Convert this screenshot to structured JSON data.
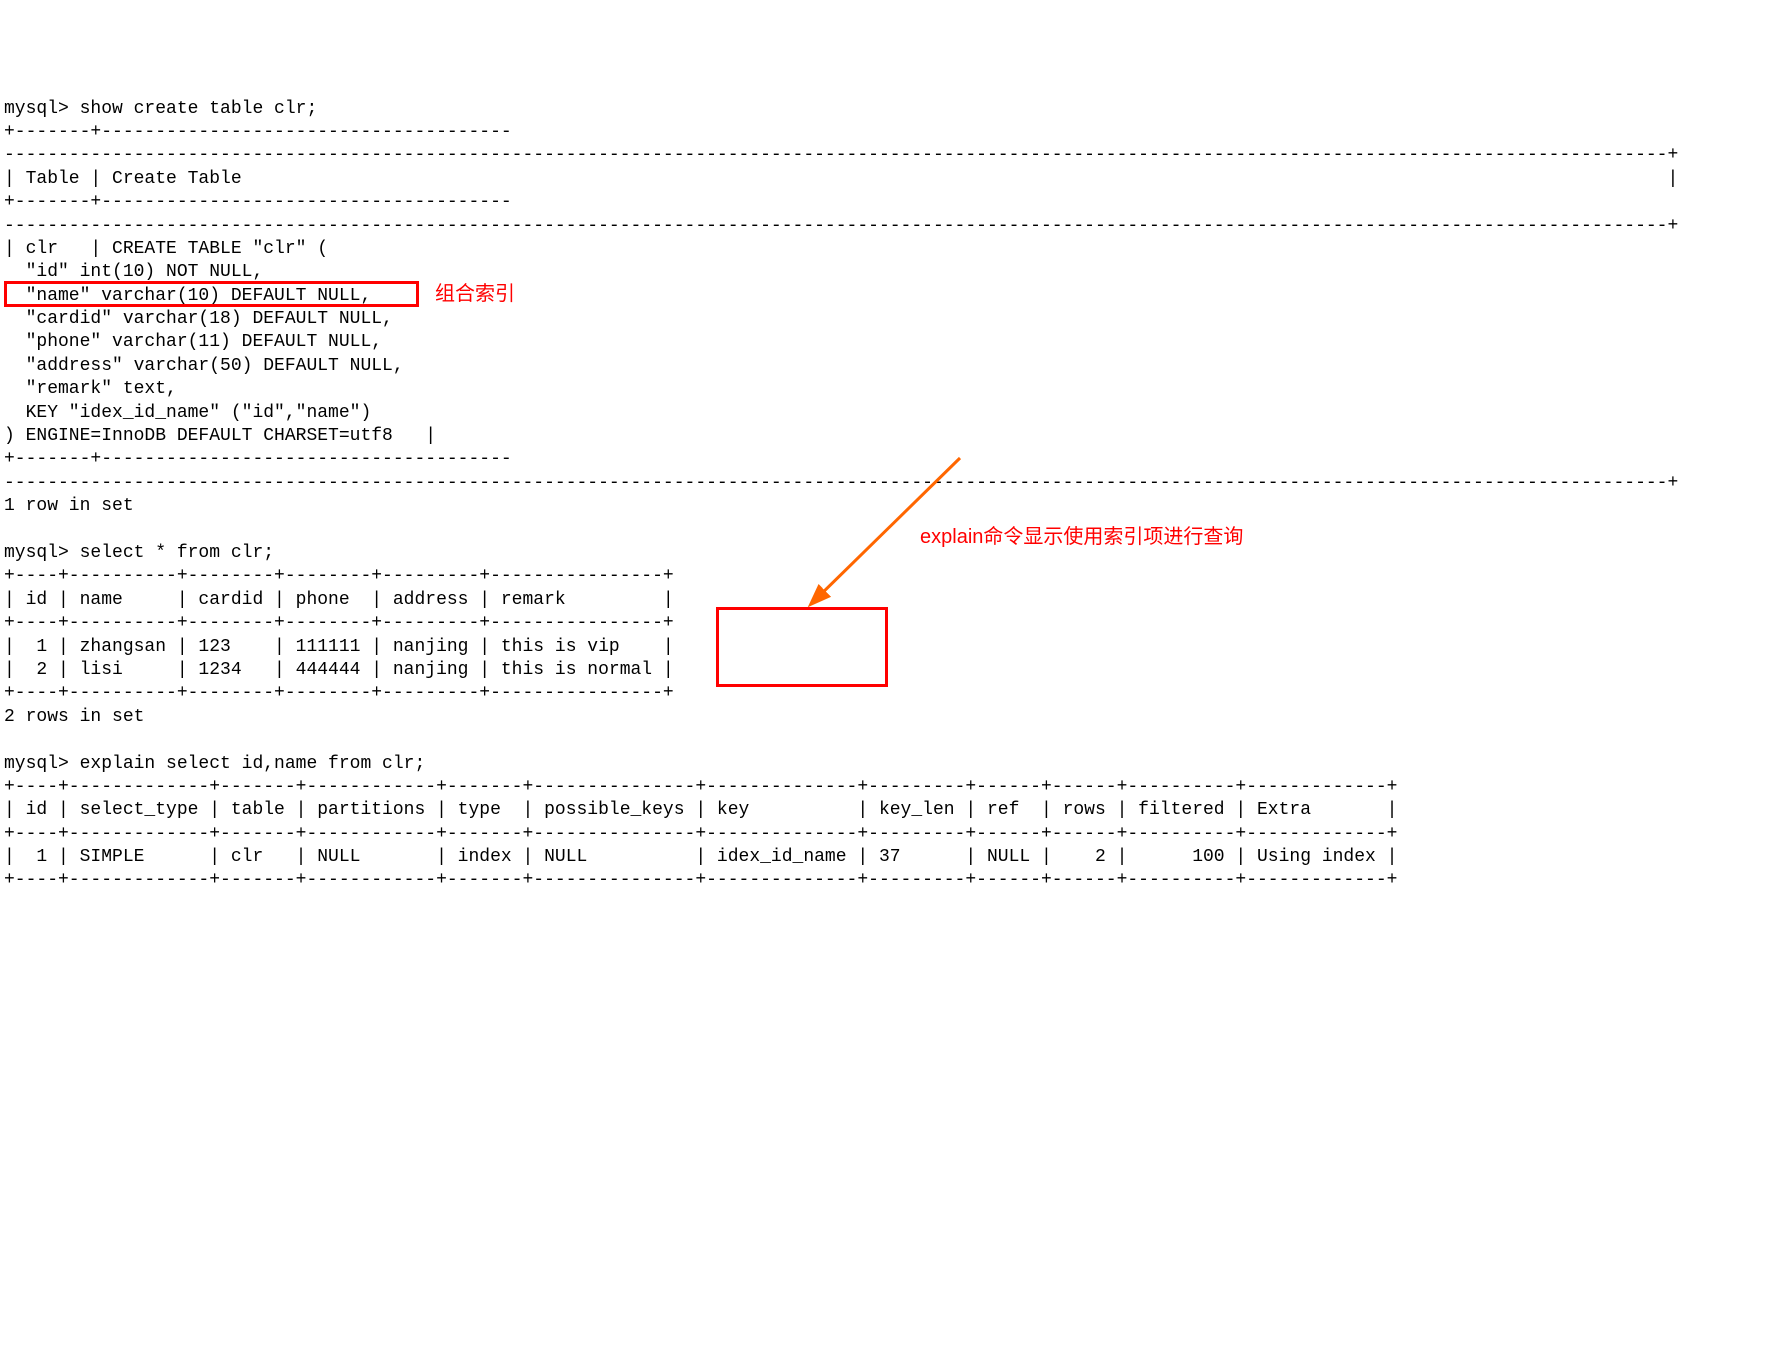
{
  "cmd1": "mysql> show create table clr;",
  "divider_short": "+-------+--------------------------------------",
  "table1_header": "| Table | Create Table",
  "trailing_bar": "|",
  "divider_long": "----------------------------------------------------------------------------------------------------------------------------------------------------------+",
  "ct1": "| clr   | CREATE TABLE \"clr\" (",
  "ct2": "  \"id\" int(10) NOT NULL,",
  "ct3": "  \"name\" varchar(10) DEFAULT NULL,",
  "ct4": "  \"cardid\" varchar(18) DEFAULT NULL,",
  "ct5": "  \"phone\" varchar(11) DEFAULT NULL,",
  "ct6": "  \"address\" varchar(50) DEFAULT NULL,",
  "ct7": "  \"remark\" text,",
  "ct8": "  KEY \"idex_id_name\" (\"id\",\"name\")",
  "ct9": ") ENGINE=InnoDB DEFAULT CHARSET=utf8   |",
  "anno1": "组合索引",
  "rows1": "1 row in set",
  "cmd2": "mysql> select * from clr;",
  "t2_div": "+----+----------+--------+--------+---------+----------------+",
  "t2_hdr": "| id | name     | cardid | phone  | address | remark         |",
  "t2_r1": "|  1 | zhangsan | 123    | 111111 | nanjing | this is vip    |",
  "t2_r2": "|  2 | lisi     | 1234   | 444444 | nanjing | this is normal |",
  "rows2": "2 rows in set",
  "anno2": "explain命令显示使用索引项进行查询",
  "cmd3": "mysql> explain select id,name from clr;",
  "t3_div": "+----+-------------+-------+------------+-------+---------------+--------------+---------+------+------+----------+-------------+",
  "t3_hdr": "| id | select_type | table | partitions | type  | possible_keys | key          | key_len | ref  | rows | filtered | Extra       |",
  "t3_r1": "|  1 | SIMPLE      | clr   | NULL       | index | NULL          | idex_id_name | 37      | NULL |    2 |      100 | Using index |",
  "highlight_colors": {
    "red": "#ff0000",
    "arrow": "#ff6600"
  }
}
